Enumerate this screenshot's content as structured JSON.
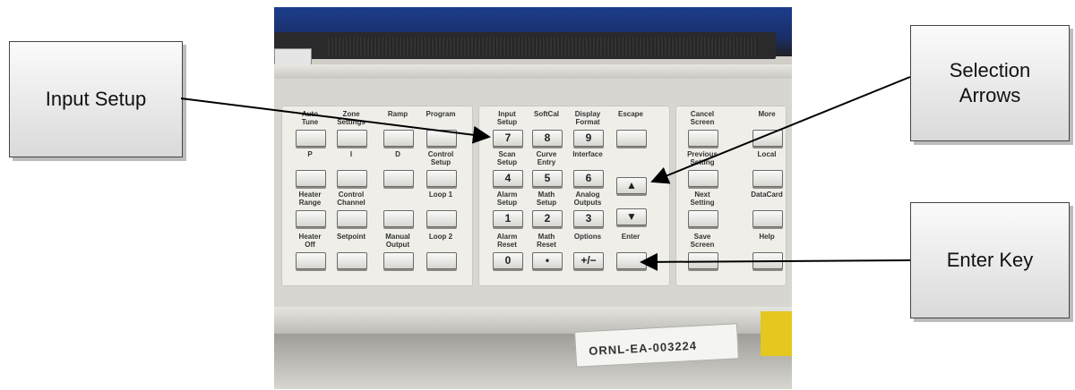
{
  "callouts": {
    "input_setup": "Input Setup",
    "selection_arrows_1": "Selection",
    "selection_arrows_2": "Arrows",
    "enter_key": "Enter Key"
  },
  "panel_left": {
    "row1": [
      "Auto\nTune",
      "Zone\nSettings",
      "Ramp",
      "Program"
    ],
    "row2": [
      "P",
      "I",
      "D",
      "Control\nSetup"
    ],
    "row3": [
      "Heater\nRange",
      "Control\nChannel",
      "",
      "Loop 1"
    ],
    "row4": [
      "Heater\nOff",
      "Setpoint",
      "Manual\nOutput",
      "Loop 2"
    ]
  },
  "panel_middle": {
    "row1": [
      {
        "label": "Input\nSetup",
        "key": "7"
      },
      {
        "label": "SoftCal",
        "key": "8"
      },
      {
        "label": "Display\nFormat",
        "key": "9"
      },
      {
        "label": "Escape",
        "key": ""
      }
    ],
    "row2": [
      {
        "label": "Scan\nSetup",
        "key": "4"
      },
      {
        "label": "Curve\nEntry",
        "key": "5"
      },
      {
        "label": "Interface",
        "key": "6"
      },
      {
        "label": "",
        "key": "▲"
      }
    ],
    "row3": [
      {
        "label": "Alarm\nSetup",
        "key": "1"
      },
      {
        "label": "Math\nSetup",
        "key": "2"
      },
      {
        "label": "Analog\nOutputs",
        "key": "3"
      },
      {
        "label": "",
        "key": "▼"
      }
    ],
    "row4": [
      {
        "label": "Alarm\nReset",
        "key": "0"
      },
      {
        "label": "Math\nReset",
        "key": "•"
      },
      {
        "label": "Options",
        "key": "+/−"
      },
      {
        "label": "Enter",
        "key": ""
      }
    ]
  },
  "panel_right": {
    "row1": [
      "Cancel\nScreen",
      "More"
    ],
    "row2": [
      "Previous\nSetting",
      "Local"
    ],
    "row3": [
      "Next\nSetting",
      "DataCard"
    ],
    "row4": [
      "Save\nScreen",
      "Help"
    ]
  },
  "sticker": "ORNL-EA-003224"
}
